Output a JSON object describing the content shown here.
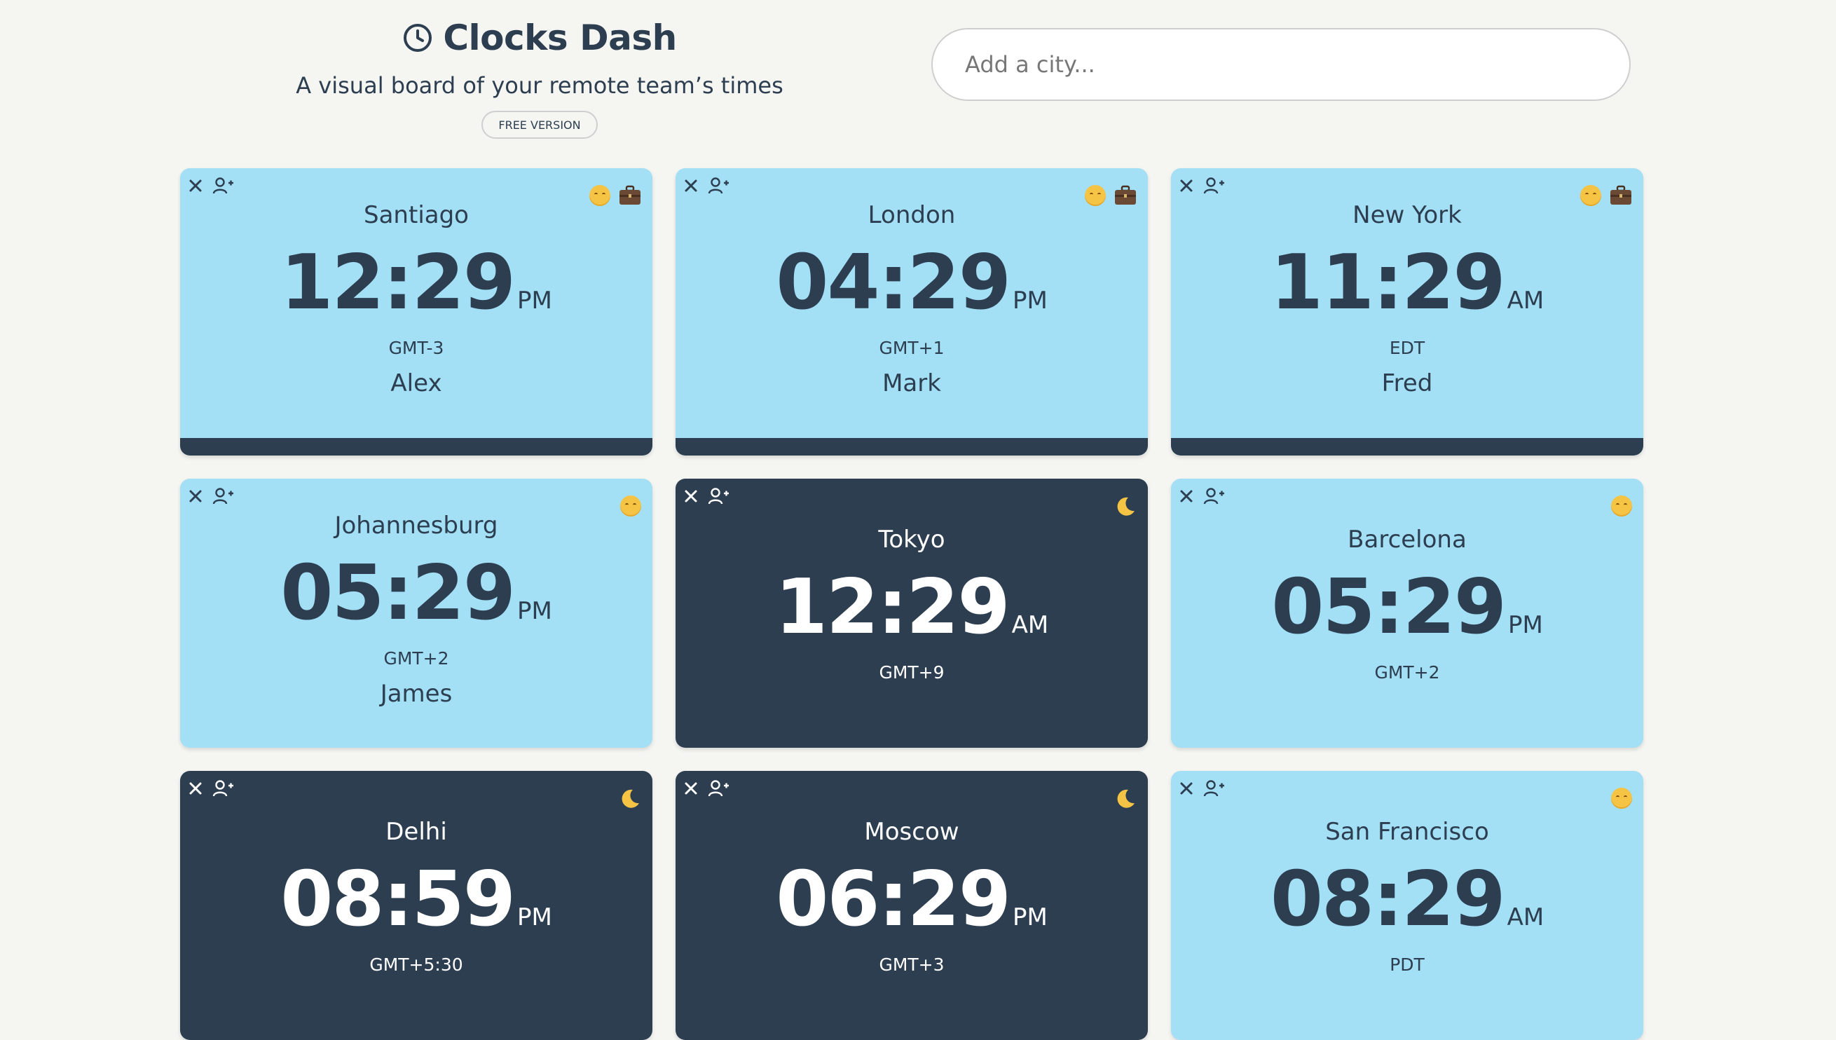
{
  "app": {
    "title": "Clocks Dash",
    "subtitle": "A visual board of your remote team’s times",
    "badge": "FREE VERSION"
  },
  "search": {
    "placeholder": "Add a city..."
  },
  "colors": {
    "day_card": "#a3dff5",
    "night_card": "#2c3e50",
    "text_dark": "#2c3e50",
    "background": "#f5f5f2"
  },
  "cards": [
    {
      "city": "Santiago",
      "time": "12:29",
      "ampm": "PM",
      "tz": "GMT-3",
      "person": "Alex",
      "mode": "day",
      "icons": [
        "sun-face-icon",
        "briefcase-icon"
      ]
    },
    {
      "city": "London",
      "time": "04:29",
      "ampm": "PM",
      "tz": "GMT+1",
      "person": "Mark",
      "mode": "day",
      "icons": [
        "sun-face-icon",
        "briefcase-icon"
      ]
    },
    {
      "city": "New York",
      "time": "11:29",
      "ampm": "AM",
      "tz": "EDT",
      "person": "Fred",
      "mode": "day",
      "icons": [
        "sun-face-icon",
        "briefcase-icon"
      ]
    },
    {
      "city": "Johannesburg",
      "time": "05:29",
      "ampm": "PM",
      "tz": "GMT+2",
      "person": "James",
      "mode": "day",
      "icons": [
        "sun-face-icon"
      ]
    },
    {
      "city": "Tokyo",
      "time": "12:29",
      "ampm": "AM",
      "tz": "GMT+9",
      "person": "",
      "mode": "night",
      "icons": [
        "moon-icon"
      ]
    },
    {
      "city": "Barcelona",
      "time": "05:29",
      "ampm": "PM",
      "tz": "GMT+2",
      "person": "",
      "mode": "day",
      "icons": [
        "sun-face-icon"
      ]
    },
    {
      "city": "Delhi",
      "time": "08:59",
      "ampm": "PM",
      "tz": "GMT+5:30",
      "person": "",
      "mode": "night",
      "icons": [
        "moon-icon"
      ]
    },
    {
      "city": "Moscow",
      "time": "06:29",
      "ampm": "PM",
      "tz": "GMT+3",
      "person": "",
      "mode": "night",
      "icons": [
        "moon-icon"
      ]
    },
    {
      "city": "San Francisco",
      "time": "08:29",
      "ampm": "AM",
      "tz": "PDT",
      "person": "",
      "mode": "day",
      "icons": [
        "sun-face-icon"
      ]
    }
  ]
}
